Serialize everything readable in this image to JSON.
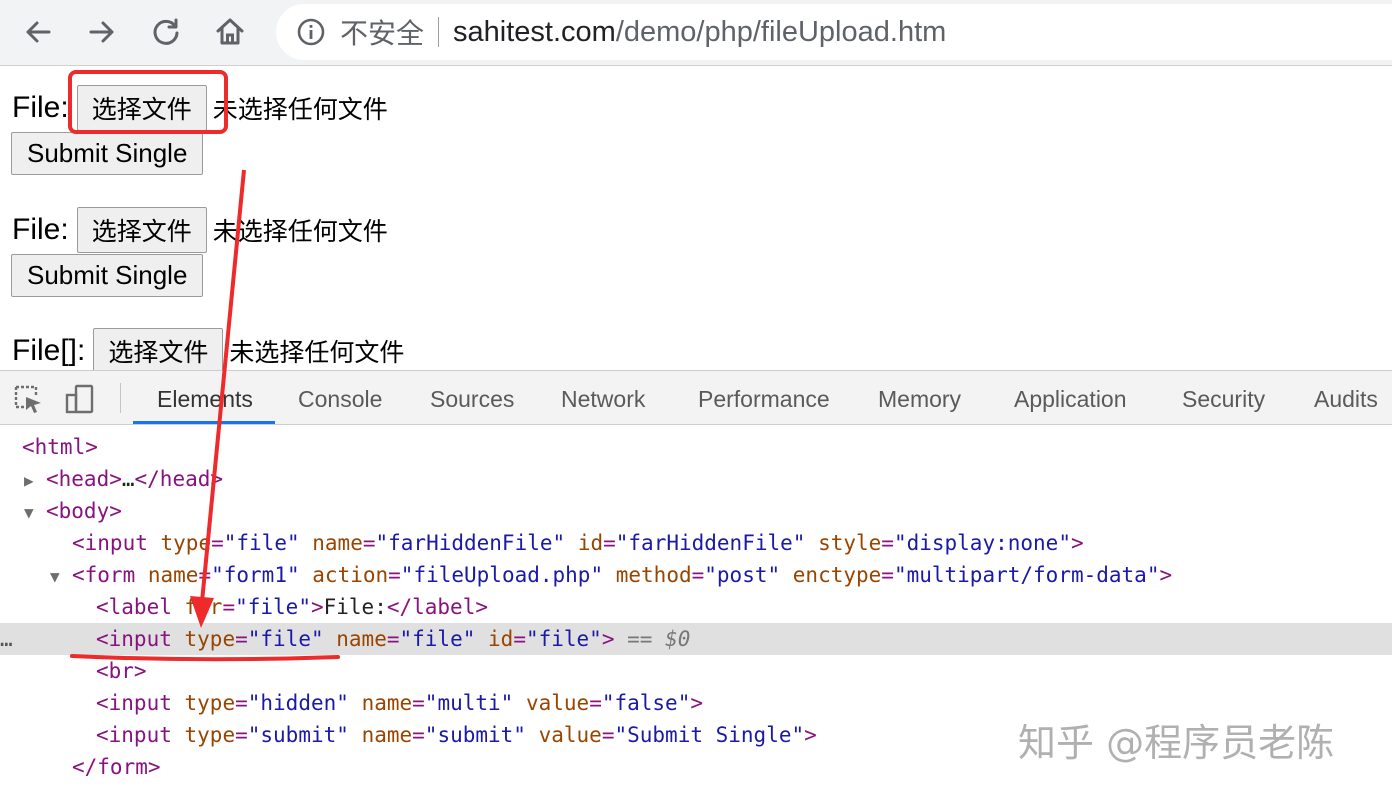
{
  "browser": {
    "security_label": "不安全",
    "url_host": "sahitest.com",
    "url_path": "/demo/php/fileUpload.htm"
  },
  "page": {
    "forms": [
      {
        "label": "File:",
        "choose_button": "选择文件",
        "no_file_text": "未选择任何文件",
        "submit_label": "Submit Single"
      },
      {
        "label": "File:",
        "choose_button": "选择文件",
        "no_file_text": "未选择任何文件",
        "submit_label": "Submit Single"
      },
      {
        "label": "File[]:",
        "choose_button": "选择文件",
        "no_file_text": "未选择任何文件"
      }
    ]
  },
  "devtools": {
    "tabs": [
      "Elements",
      "Console",
      "Sources",
      "Network",
      "Performance",
      "Memory",
      "Application",
      "Security",
      "Audits"
    ],
    "active_tab": "Elements",
    "selected_marker": "== $0",
    "ellipsis": "…"
  },
  "colors": {
    "annotation_red": "#ee2a2a",
    "tab_active_underline": "#1a73e8",
    "dom_tag": "#881280",
    "dom_attr": "#994500",
    "dom_value": "#1a1aa6"
  },
  "watermark": "知乎 @程序员老陈"
}
